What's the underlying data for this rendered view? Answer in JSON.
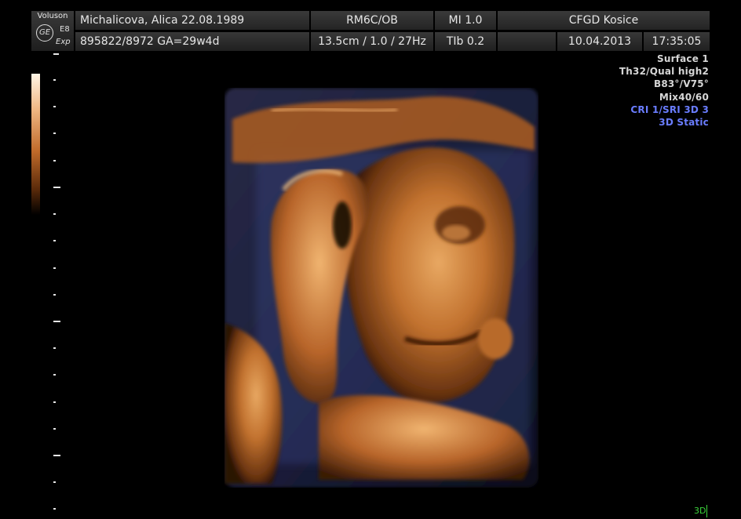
{
  "header": {
    "brand": "Voluson",
    "logo": "GE",
    "model": "E8",
    "model_suffix": "Exp",
    "patient": "Michalicova, Alica  22.08.1989",
    "id_ga": "895822/8972  GA=29w4d",
    "probe": "RM6C/OB",
    "depth_freq": "13.5cm / 1.0 / 27Hz",
    "mi": "MI  1.0",
    "tib": "TIb  0.2",
    "institution": "CFGD Kosice",
    "date": "10.04.2013",
    "time": "17:35:05"
  },
  "settings": [
    {
      "text": "Surface 1",
      "color": "white"
    },
    {
      "text": "Th32/Qual high2",
      "color": "white"
    },
    {
      "text": "B83°/V75°",
      "color": "white"
    },
    {
      "text": "Mix40/60",
      "color": "white"
    },
    {
      "text": "CRI 1/SRI 3D 3",
      "color": "blue"
    },
    {
      "text": "3D Static",
      "color": "blue"
    }
  ],
  "mode_label": "3D",
  "image_subject": "3D surface-rendered fetal face with hand",
  "colors": {
    "accent_blue": "#6a7dff",
    "mode_green": "#3bd43b",
    "render_tone": "#c8783a"
  }
}
